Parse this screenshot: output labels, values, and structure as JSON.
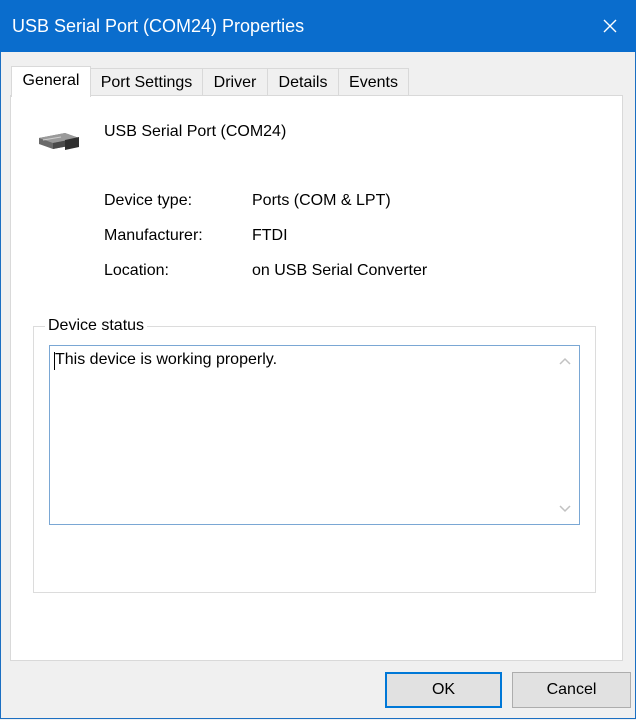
{
  "window": {
    "title": "USB Serial Port (COM24) Properties"
  },
  "tabs": [
    {
      "label": "General",
      "active": true
    },
    {
      "label": "Port Settings",
      "active": false
    },
    {
      "label": "Driver",
      "active": false
    },
    {
      "label": "Details",
      "active": false
    },
    {
      "label": "Events",
      "active": false
    }
  ],
  "general": {
    "device_icon": "serial-port-connector-icon",
    "device_name": "USB Serial Port (COM24)",
    "properties": [
      {
        "label": "Device type:",
        "value": "Ports (COM & LPT)"
      },
      {
        "label": "Manufacturer:",
        "value": "FTDI"
      },
      {
        "label": "Location:",
        "value": "on USB Serial Converter"
      }
    ],
    "status_group_label": "Device status",
    "status_text": "This device is working properly."
  },
  "buttons": {
    "ok": "OK",
    "cancel": "Cancel"
  },
  "colors": {
    "titlebar": "#0a6dcd",
    "default_button_border": "#0078d7",
    "textbox_border": "#7aa7d4"
  }
}
